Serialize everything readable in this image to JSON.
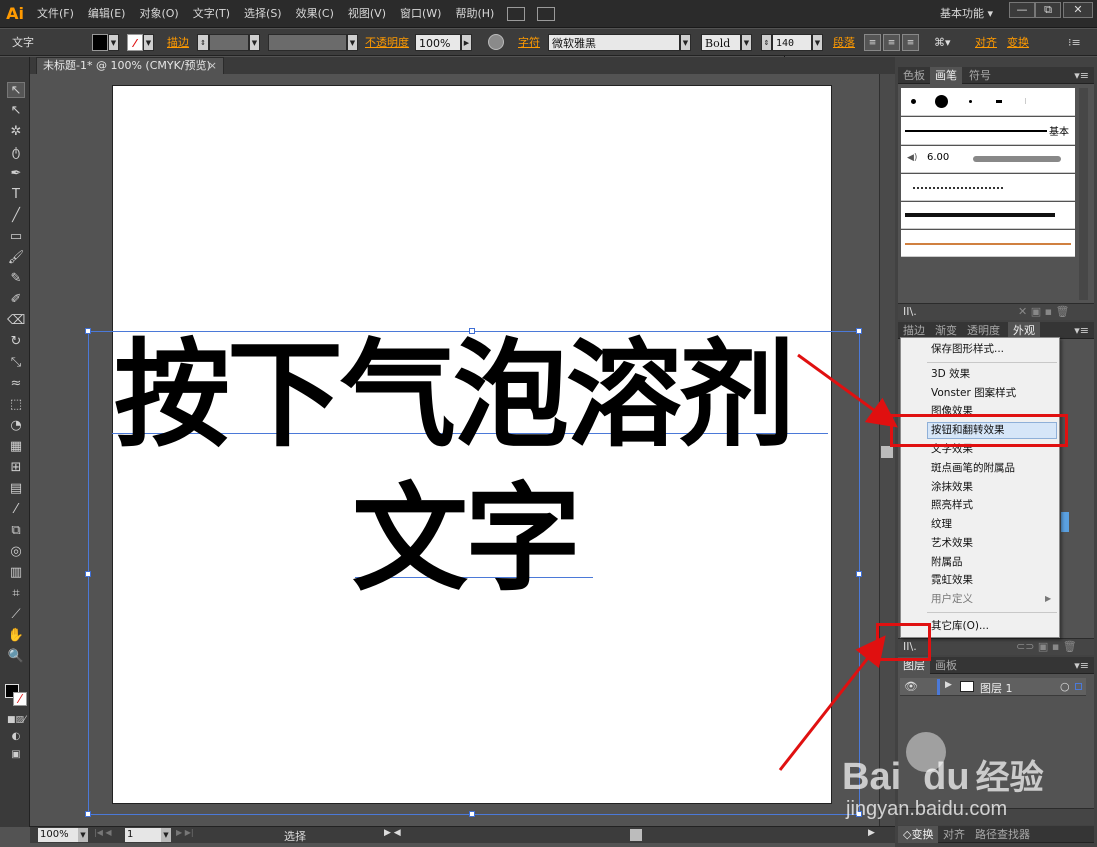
{
  "app": {
    "logo": "Ai",
    "menus": [
      "文件(F)",
      "编辑(E)",
      "对象(O)",
      "文字(T)",
      "选择(S)",
      "效果(C)",
      "视图(V)",
      "窗口(W)",
      "帮助(H)"
    ],
    "workspace": "基本功能",
    "window_buttons": [
      "—",
      "⧉",
      "✕"
    ]
  },
  "control_bar": {
    "tool_label": "文字",
    "stroke_label": "描边",
    "opacity_label": "不透明度",
    "opacity_value": "100%",
    "character_label": "字符",
    "font_family": "微软雅黑",
    "font_style": "Bold",
    "font_size": "140 pt",
    "paragraph_label": "段落",
    "align_label": "对齐",
    "transform_label": "变换"
  },
  "document": {
    "tab_title": "未标题-1* @ 100% (CMYK/预览)",
    "tab_close": "×",
    "line1": "按下气泡溶剂",
    "line2": "文字"
  },
  "status_bar": {
    "zoom": "100%",
    "artboard_number": "1",
    "status_text": "选择"
  },
  "panels": {
    "top_tabs": [
      "色板",
      "画笔",
      "符号"
    ],
    "top_active": "画笔",
    "brush_basic_label": "基本",
    "brush_size_label": "6.00",
    "mid_tabs": [
      "描边",
      "渐变",
      "透明度",
      "外观"
    ],
    "mid_active": "外观",
    "layer_tabs": [
      "图层",
      "画板"
    ],
    "layer_active": "图层",
    "layer_name": "图层 1",
    "bottom_tabs": [
      "变换",
      "对齐",
      "路径查找器"
    ]
  },
  "graphic_styles_menu": {
    "items": [
      "保存图形样式...",
      "3D 效果",
      "Vonster 图案样式",
      "图像效果",
      "按钮和翻转效果",
      "文字效果",
      "斑点画笔的附属品",
      "涂抹效果",
      "照亮样式",
      "纹理",
      "艺术效果",
      "附属品",
      "霓虹效果",
      "用户定义",
      "其它库(O)..."
    ],
    "highlighted": "按钮和翻转效果"
  },
  "watermark": {
    "brand": "Bai",
    "brand2": "du",
    "product": "经验",
    "url": "jingyan.baidu.com"
  },
  "colors": {
    "accent_orange": "#ff9a00",
    "annotation_red": "#e01010",
    "selection_blue": "#4b79d8",
    "ui_dark": "#535353"
  }
}
